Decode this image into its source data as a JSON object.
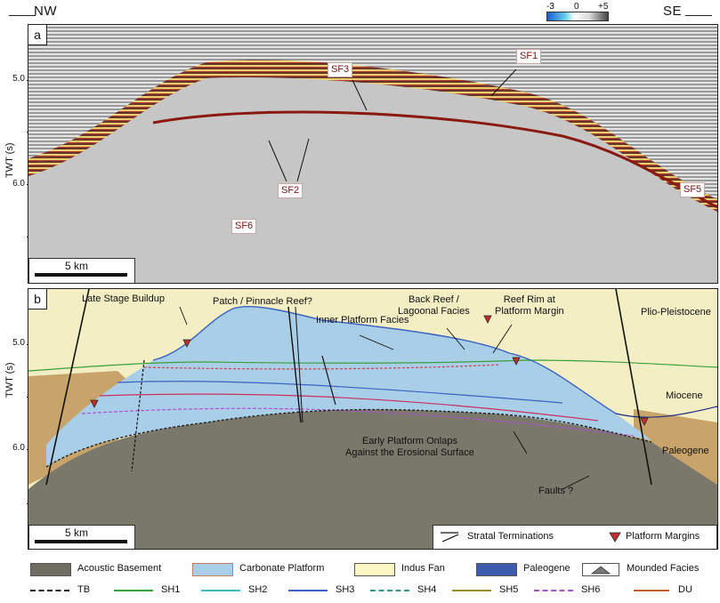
{
  "orientation": {
    "left": "NW",
    "right": "SE"
  },
  "axis": {
    "label": "TWT (s)",
    "ticks": [
      "5.0",
      "6.0"
    ]
  },
  "colorbar": {
    "min": "-3",
    "mid": "0",
    "max": "+5"
  },
  "panel_a": {
    "tag": "a",
    "labels": [
      "SF1",
      "SF2",
      "SF3",
      "SF5",
      "SF6"
    ],
    "scale": "5 km"
  },
  "panel_b": {
    "tag": "b",
    "annotations": {
      "late_stage": "Late Stage Buildup",
      "patch_reef": "Patch / Pinnacle Reef?",
      "inner_platform": "Inner Platform Facies",
      "back_reef": "Back Reef /\nLagoonal Facies",
      "reef_rim": "Reef Rim at\nPlatform Margin",
      "early_onlap": "Early Platform Onlaps\nAgainst the Erosional Surface",
      "faults": "Faults ?"
    },
    "zones": [
      "Plio-Pleistocene",
      "Miocene",
      "Paleogene"
    ],
    "scale": "5 km",
    "key": {
      "strat": "Stratal Terminations",
      "margins": "Platform Margins"
    }
  },
  "legend": {
    "fills": [
      {
        "label": "Acoustic Basement",
        "color": "#6f6d62"
      },
      {
        "label": "Carbonate Platform",
        "color": "#a9cfe8"
      },
      {
        "label": "Indus Fan",
        "color": "#fbf6c2"
      },
      {
        "label": "Paleogene",
        "color": "#3d5cae"
      },
      {
        "label": "Mounded Facies",
        "color": "#777777"
      }
    ],
    "lines": [
      {
        "label": "TB",
        "color": "#222222"
      },
      {
        "label": "SH1",
        "color": "#3aa03a"
      },
      {
        "label": "SH2",
        "color": "#3fb6c8"
      },
      {
        "label": "SH3",
        "color": "#3a62c0"
      },
      {
        "label": "SH4",
        "color": "#2a9a8a"
      },
      {
        "label": "SH5",
        "color": "#9a8a2a"
      },
      {
        "label": "SH6",
        "color": "#b050d0"
      },
      {
        "label": "DU",
        "color": "#b8602a"
      }
    ]
  }
}
